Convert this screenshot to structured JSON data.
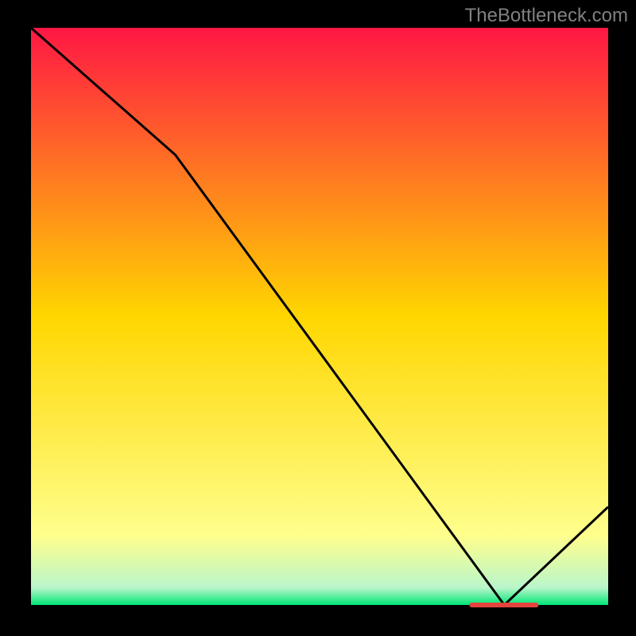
{
  "attribution": "TheBottleneck.com",
  "chart_data": {
    "type": "line",
    "title": "",
    "xlabel": "",
    "ylabel": "",
    "xlim": [
      0,
      100
    ],
    "ylim": [
      0,
      100
    ],
    "x": [
      0,
      25,
      82,
      100
    ],
    "values": [
      100,
      78,
      0,
      17
    ],
    "gradient_stops": [
      {
        "offset": 0,
        "color": "#ff1744"
      },
      {
        "offset": 50,
        "color": "#ffd600"
      },
      {
        "offset": 88,
        "color": "#ffff8d"
      },
      {
        "offset": 97,
        "color": "#b9f6ca"
      },
      {
        "offset": 100,
        "color": "#00e676"
      }
    ],
    "marker": {
      "x": 82,
      "y": 0,
      "width": 12
    }
  }
}
